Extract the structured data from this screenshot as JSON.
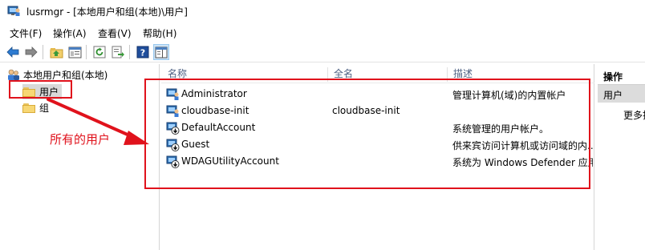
{
  "window": {
    "title": "lusrmgr - [本地用户和组(本地)\\用户]"
  },
  "menu": [
    "文件(F)",
    "操作(A)",
    "查看(V)",
    "帮助(H)"
  ],
  "toolbar_icons": [
    "back-arrow-icon",
    "forward-arrow-icon",
    "up-folder-icon",
    "show-hide-tree-icon",
    "refresh-icon",
    "export-list-icon",
    "help-icon",
    "action-pane-icon"
  ],
  "tree": {
    "root": "本地用户和组(本地)",
    "items": [
      {
        "label": "用户",
        "selected": true
      },
      {
        "label": "组",
        "selected": false
      }
    ]
  },
  "list": {
    "columns": [
      "名称",
      "全名",
      "描述"
    ],
    "rows": [
      {
        "name": "Administrator",
        "full_name": "",
        "description": "管理计算机(域)的内置帐户",
        "disabled": false
      },
      {
        "name": "cloudbase-init",
        "full_name": "cloudbase-init",
        "description": "",
        "disabled": false
      },
      {
        "name": "DefaultAccount",
        "full_name": "",
        "description": "系统管理的用户帐户。",
        "disabled": true
      },
      {
        "name": "Guest",
        "full_name": "",
        "description": "供来宾访问计算机或访问域的内...",
        "disabled": true
      },
      {
        "name": "WDAGUtilityAccount",
        "full_name": "",
        "description": "系统为 Windows Defender 应用",
        "disabled": true
      }
    ]
  },
  "actions": {
    "header": "操作",
    "section": "用户",
    "more": "更多操作"
  },
  "annotation": {
    "text": "所有的用户",
    "color": "#e0121c"
  }
}
